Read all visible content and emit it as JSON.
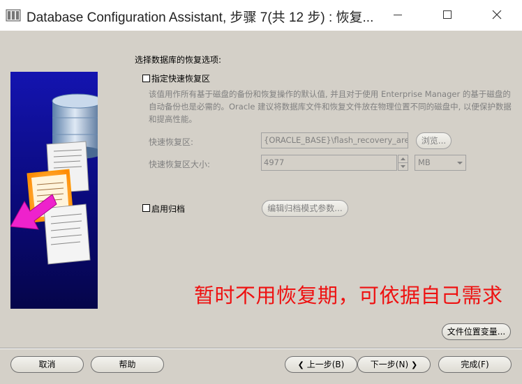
{
  "window": {
    "title": "Database Configuration Assistant, 步骤 7(共 12 步) : 恢复..."
  },
  "heading": "选择数据库的恢复选项:",
  "recovery_area": {
    "checkbox_label": "指定快速恢复区",
    "checked": false,
    "description": "该值用作所有基于磁盘的备份和恢复操作的默认值, 并且对于使用 Enterprise Manager 的基于磁盘的自动备份也是必需的。Oracle 建议将数据库文件和恢复文件放在物理位置不同的磁盘中, 以便保护数据和提高性能。",
    "area_label": "快速恢复区:",
    "area_value": "{ORACLE_BASE}\\flash_recovery_area",
    "browse_label": "浏览...",
    "size_label": "快速恢复区大小:",
    "size_value": "4977",
    "size_unit": "MB"
  },
  "archive": {
    "checkbox_label": "启用归档",
    "checked": false,
    "params_button": "编辑归档模式参数..."
  },
  "annotation": "暂时不用恢复期，可依据自己需求",
  "file_location_button": "文件位置变量...",
  "footer": {
    "cancel": "取消",
    "help": "帮助",
    "back": "上一步(B)",
    "next": "下一步(N)",
    "finish": "完成(F)"
  },
  "colors": {
    "annotation": "#ee1111",
    "dialog_bg": "#d4d0c8",
    "side_panel": "#0a0a8a"
  }
}
